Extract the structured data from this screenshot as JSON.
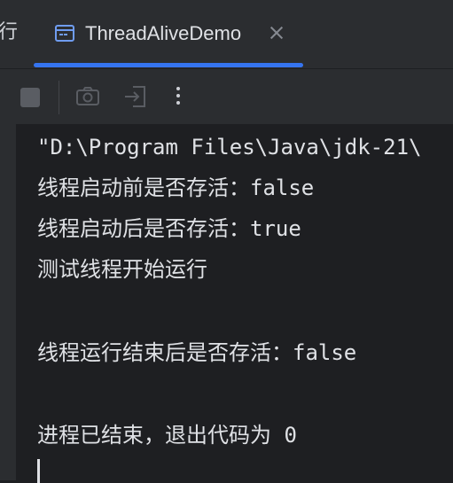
{
  "tabs": {
    "partial_label": "行",
    "active": {
      "icon": "console-window-icon",
      "label": "ThreadAliveDemo",
      "close_icon": "close-icon"
    }
  },
  "toolbar": {
    "buttons": [
      {
        "icon": "stop-icon",
        "enabled": false
      },
      {
        "icon": "camera-icon",
        "enabled": false
      },
      {
        "icon": "exit-icon",
        "enabled": false
      },
      {
        "icon": "more-vertical-icon",
        "enabled": true
      }
    ]
  },
  "console": {
    "lines": [
      "\"D:\\Program Files\\Java\\jdk-21\\",
      "线程启动前是否存活：false",
      "线程启动后是否存活：true",
      "测试线程开始运行",
      "",
      "线程运行结束后是否存活：false",
      "",
      "进程已结束，退出代码为 0"
    ]
  },
  "colors": {
    "background": "#1e1f22",
    "panel": "#2b2d30",
    "accent": "#3574f0",
    "text": "#dfe1e5"
  }
}
